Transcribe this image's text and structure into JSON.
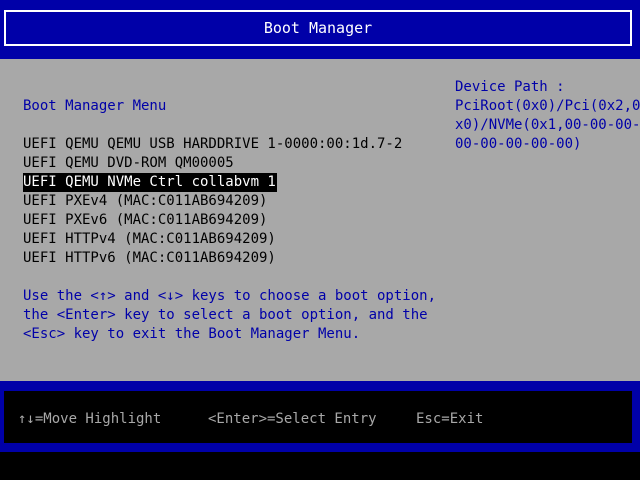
{
  "header": {
    "title": "Boot Manager"
  },
  "menu": {
    "title": "Boot Manager Menu",
    "options": [
      {
        "label": "UEFI QEMU QEMU USB HARDDRIVE 1-0000:00:1d.7-2",
        "selected": false
      },
      {
        "label": "UEFI QEMU DVD-ROM QM00005",
        "selected": false
      },
      {
        "label": "UEFI QEMU NVMe Ctrl collabvm 1",
        "selected": true
      },
      {
        "label": "UEFI PXEv4 (MAC:C011AB694209)",
        "selected": false
      },
      {
        "label": "UEFI PXEv6 (MAC:C011AB694209)",
        "selected": false
      },
      {
        "label": "UEFI HTTPv4 (MAC:C011AB694209)",
        "selected": false
      },
      {
        "label": "UEFI HTTPv6 (MAC:C011AB694209)",
        "selected": false
      }
    ],
    "help_lines": [
      "Use the <↑> and <↓> keys to choose a boot option,",
      "the <Enter> key to select a boot option, and the",
      "<Esc> key to exit the Boot Manager Menu."
    ]
  },
  "device_path": {
    "label": "Device Path :",
    "lines": [
      "PciRoot(0x0)/Pci(0x2,0",
      "x0)/NVMe(0x1,00-00-00-",
      "00-00-00-00-00)"
    ]
  },
  "footer": {
    "hints": [
      "↑↓=Move Highlight",
      "<Enter>=Select Entry",
      "Esc=Exit"
    ]
  },
  "colors": {
    "bios_blue": "#0000a8",
    "bios_gray": "#a8a8a8",
    "black": "#000000",
    "white": "#ffffff"
  }
}
